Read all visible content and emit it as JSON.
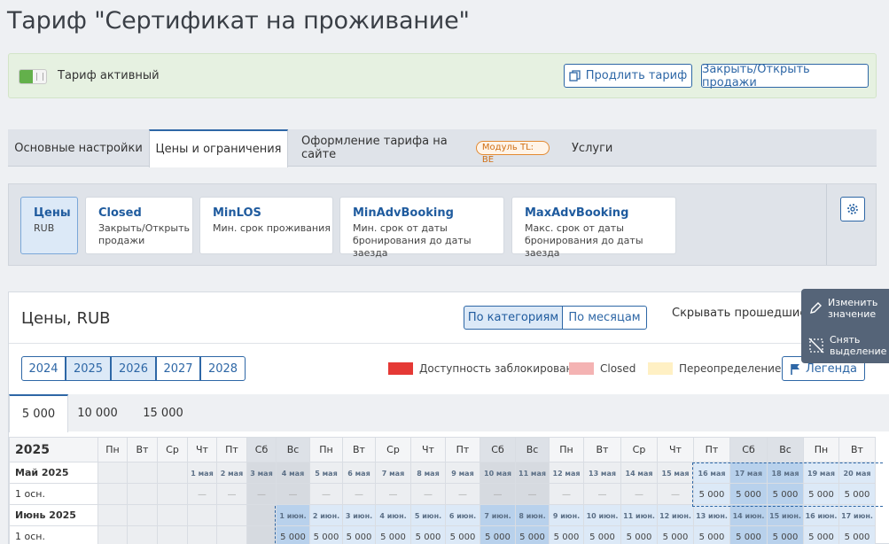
{
  "page": {
    "title": "Тариф \"Сертификат на проживание\""
  },
  "banner": {
    "status_label": "Тариф активный",
    "extend_label": "Продлить тариф",
    "sales_label": "Закрыть/Открыть продажи"
  },
  "tabs": [
    {
      "label": "Основные настройки"
    },
    {
      "label": "Цены и ограничения"
    },
    {
      "label": "Оформление тарифа на сайте",
      "badge": "Модуль TL: BE"
    },
    {
      "label": "Услуги"
    }
  ],
  "restriction_cards": [
    {
      "title": "Цены",
      "subtitle": "RUB"
    },
    {
      "title": "Closed",
      "subtitle": "Закрыть/Открыть продажи"
    },
    {
      "title": "MinLOS",
      "subtitle": "Мин. срок проживания"
    },
    {
      "title": "MinAdvBooking",
      "subtitle": "Мин. срок от даты бронирования до даты заезда"
    },
    {
      "title": "MaxAdvBooking",
      "subtitle": "Макс. срок от даты бронирования до даты заезда"
    }
  ],
  "prices": {
    "title": "Цены, RUB",
    "view_toggle": [
      "По категориям",
      "По месяцам"
    ],
    "hide_past_label": "Скрывать прошедшие м",
    "years": [
      "2024",
      "2025",
      "2026",
      "2027",
      "2028"
    ],
    "selected_years": [
      "2025",
      "2026"
    ],
    "legend": [
      {
        "label": "Доступность заблокирована",
        "color": "#e53935"
      },
      {
        "label": "Closed",
        "color": "#f4b3b3"
      },
      {
        "label": "Переопределение",
        "color": "#fff0c4"
      }
    ],
    "legend_button": "Легенда",
    "category_tabs": [
      "5 000",
      "10 000",
      "15 000"
    ],
    "active_category": "5 000"
  },
  "context_menu": {
    "edit_label": "Изменить значение",
    "clear_label": "Снять выделение"
  },
  "calendar": {
    "year": "2025",
    "weekdays": [
      "Пн",
      "Вт",
      "Ср",
      "Чт",
      "Пт",
      "Сб",
      "Вс",
      "Пн",
      "Вт",
      "Ср",
      "Чт",
      "Пт",
      "Сб",
      "Вс",
      "Пн",
      "Вт",
      "Ср",
      "Чт",
      "Пт",
      "Сб",
      "Вс",
      "Пн",
      "Вт"
    ],
    "months": [
      {
        "name": "Май 2025",
        "rate": "1 осн.",
        "days": [
          "",
          "",
          "",
          "1 мая",
          "2 мая",
          "3 мая",
          "4 мая",
          "5 мая",
          "6 мая",
          "7 мая",
          "8 мая",
          "9 мая",
          "10 мая",
          "11 мая",
          "12 мая",
          "13 мая",
          "14 мая",
          "15 мая",
          "16 мая",
          "17 мая",
          "18 мая",
          "19 мая",
          "20 мая"
        ],
        "prices": [
          "",
          "",
          "",
          "—",
          "—",
          "—",
          "—",
          "—",
          "—",
          "—",
          "—",
          "—",
          "—",
          "—",
          "—",
          "—",
          "—",
          "—",
          "5 000",
          "5 000",
          "5 000",
          "5 000",
          "5 000"
        ],
        "past_count": 18,
        "selected_from": 18
      },
      {
        "name": "Июнь 2025",
        "rate": "1 осн.",
        "days": [
          "",
          "",
          "",
          "",
          "",
          "",
          "1 июн.",
          "2 июн.",
          "3 июн.",
          "4 июн.",
          "5 июн.",
          "6 июн.",
          "7 июн.",
          "8 июн.",
          "9 июн.",
          "10 июн.",
          "11 июн.",
          "12 июн.",
          "13 июн.",
          "14 июн.",
          "15 июн.",
          "16 июн.",
          "17 июн."
        ],
        "prices": [
          "",
          "",
          "",
          "",
          "",
          "",
          "5 000",
          "5 000",
          "5 000",
          "5 000",
          "5 000",
          "5 000",
          "5 000",
          "5 000",
          "5 000",
          "5 000",
          "5 000",
          "5 000",
          "5 000",
          "5 000",
          "5 000",
          "5 000",
          "5 000"
        ],
        "past_count": 0,
        "selected_from": 6
      }
    ]
  }
}
